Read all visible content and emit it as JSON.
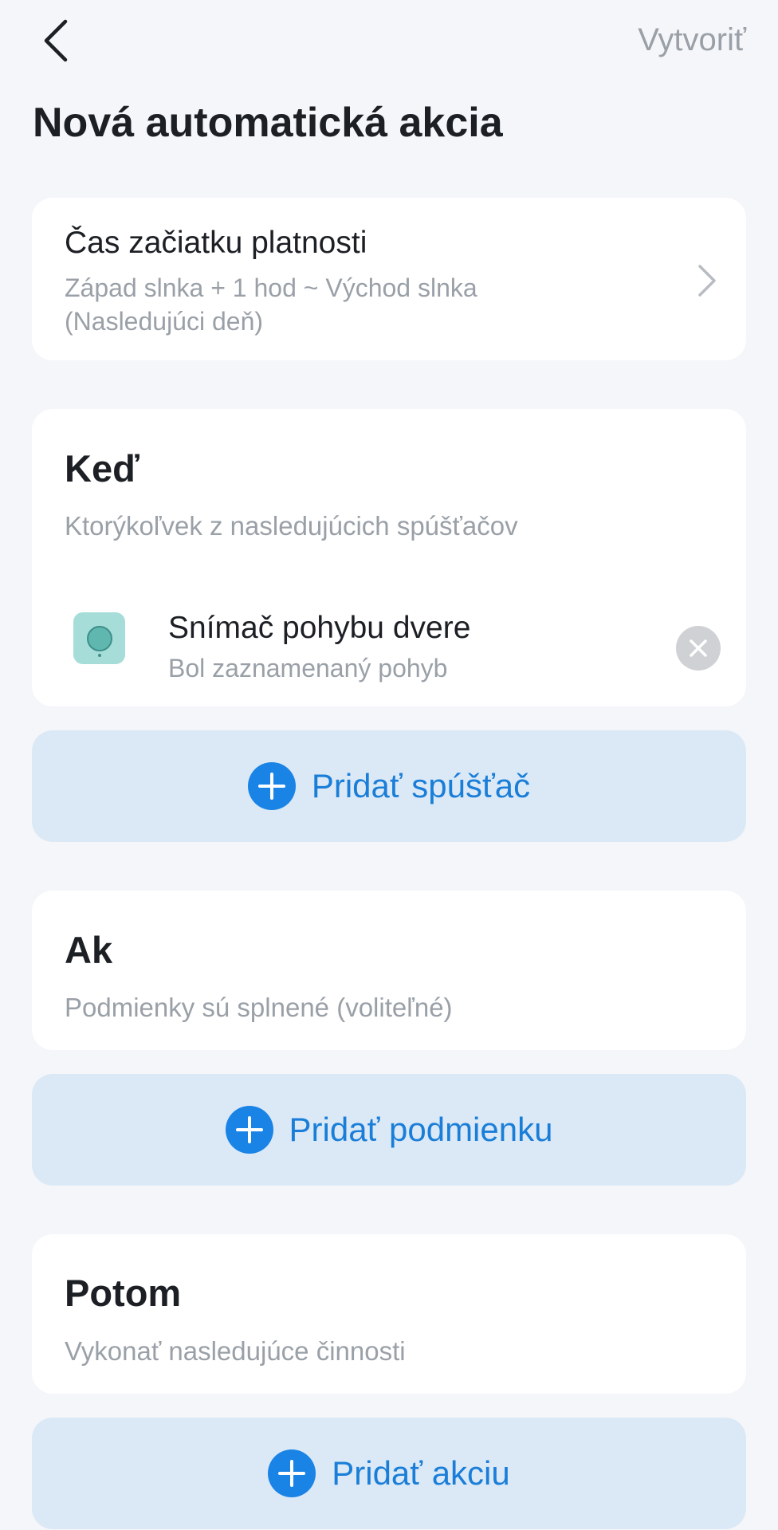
{
  "header": {
    "back_icon": "chevron-left-icon",
    "create_label": "Vytvoriť",
    "title": "Nová automatická akcia"
  },
  "validity": {
    "title": "Čas začiatku platnosti",
    "subtitle": "Západ slnka + 1 hod ~ Východ slnka (Nasledujúci deň)",
    "chevron_icon": "chevron-right-icon"
  },
  "when": {
    "title": "Keď",
    "subtitle": "Ktorýkoľvek z nasledujúcich spúšťačov",
    "triggers": [
      {
        "icon": "motion-sensor-icon",
        "name": "Snímač pohybu dvere",
        "description": "Bol zaznamenaný pohyb"
      }
    ],
    "add_label": "Pridať spúšťač"
  },
  "if": {
    "title": "Ak",
    "subtitle": "Podmienky sú splnené (voliteľné)",
    "add_label": "Pridať podmienku"
  },
  "then": {
    "title": "Potom",
    "subtitle": "Vykonať nasledujúce činnosti",
    "add_label": "Pridať akciu"
  },
  "colors": {
    "background": "#f5f6f9",
    "card": "#ffffff",
    "accent": "#1a83e6",
    "add_button_bg": "#dbe9f6",
    "muted_text": "#9aa0a7"
  }
}
